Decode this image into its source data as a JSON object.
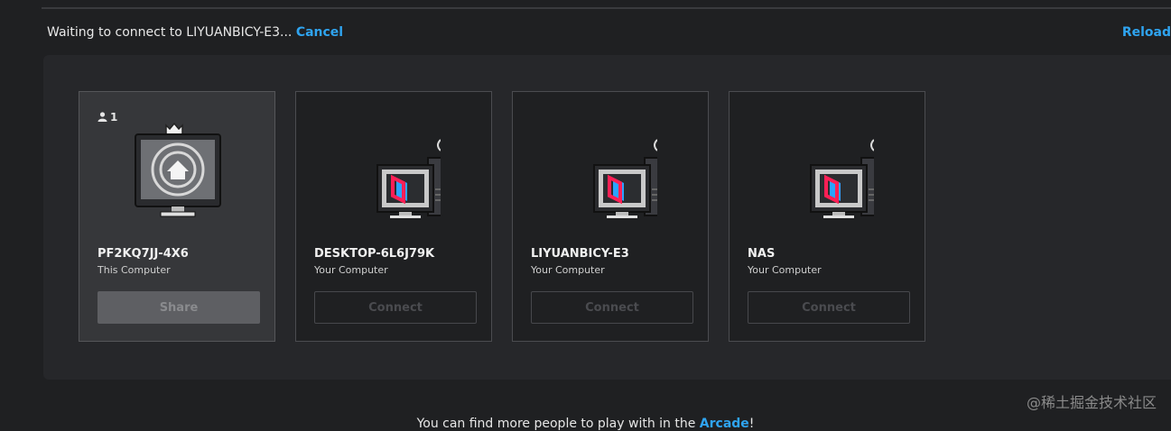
{
  "status": {
    "text": "Waiting to connect to LIYUANBICY-E3...",
    "cancel": "Cancel"
  },
  "reload": "Reload",
  "cards": [
    {
      "badge_count": "1",
      "name": "PF2KQ7JJ-4X6",
      "subtitle": "This Computer",
      "button": "Share",
      "icon": "home-monitor-icon"
    },
    {
      "name": "DESKTOP-6L6J79K",
      "subtitle": "Your Computer",
      "button": "Connect",
      "icon": "computer-icon"
    },
    {
      "name": "LIYUANBICY-E3",
      "subtitle": "Your Computer",
      "button": "Connect",
      "icon": "computer-icon"
    },
    {
      "name": "NAS",
      "subtitle": "Your Computer",
      "button": "Connect",
      "icon": "computer-icon"
    }
  ],
  "footer": {
    "text": "You can find more people to play with in the ",
    "link": "Arcade",
    "suffix": "!"
  },
  "watermark": "@稀土掘金技术社区",
  "colors": {
    "accent": "#2fa4f0",
    "logo_red": "#ff1f55",
    "logo_blue": "#2aa3ff"
  }
}
